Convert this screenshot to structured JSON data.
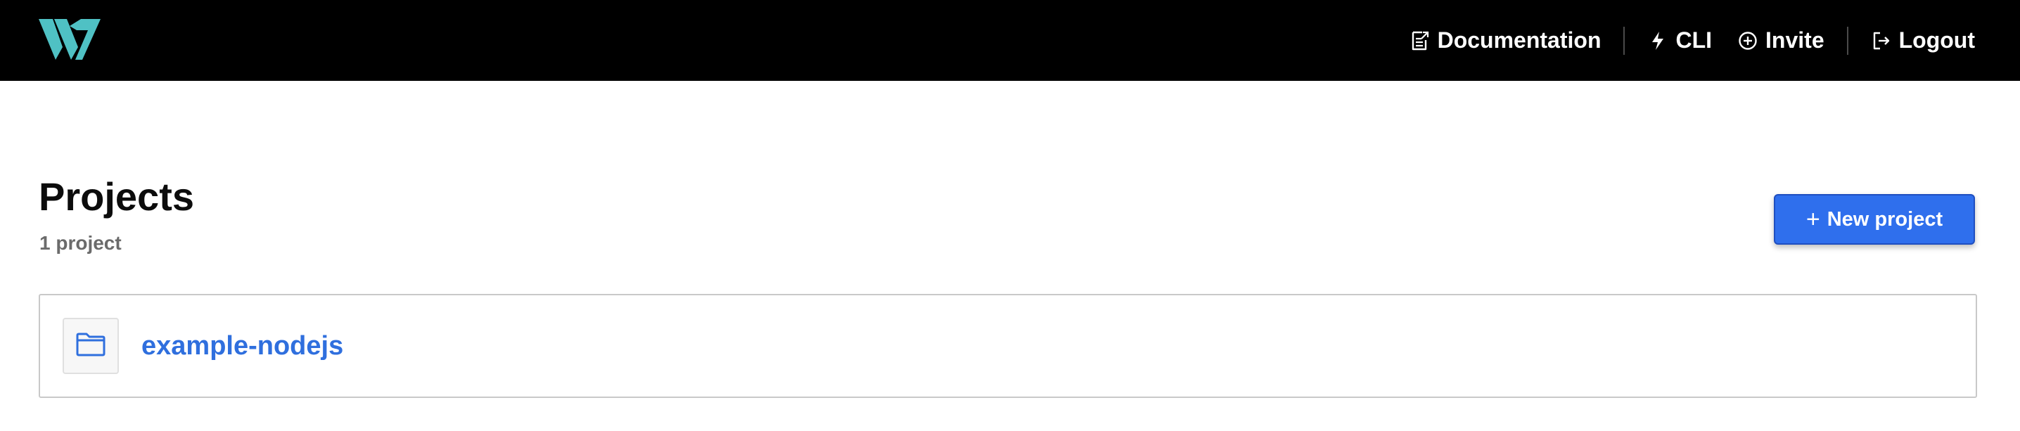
{
  "header": {
    "logo_icon": "brand-logo-icon",
    "nav": {
      "documentation": {
        "label": "Documentation",
        "icon": "document-external-icon"
      },
      "cli": {
        "label": "CLI",
        "icon": "lightning-bolt-icon"
      },
      "invite": {
        "label": "Invite",
        "icon": "plus-circle-icon"
      },
      "logout": {
        "label": "Logout",
        "icon": "logout-icon"
      }
    }
  },
  "main": {
    "title": "Projects",
    "subtitle": "1 project",
    "new_project_label": "New project",
    "new_project_icon": "plus-icon",
    "projects": [
      {
        "name": "example-nodejs",
        "icon": "folder-icon"
      }
    ]
  },
  "colors": {
    "topbar_bg": "#000000",
    "logo_teal": "#4fc1c4",
    "primary_blue": "#2f6fed",
    "project_link": "#2f6fde",
    "muted_text": "#6b6b6b"
  }
}
